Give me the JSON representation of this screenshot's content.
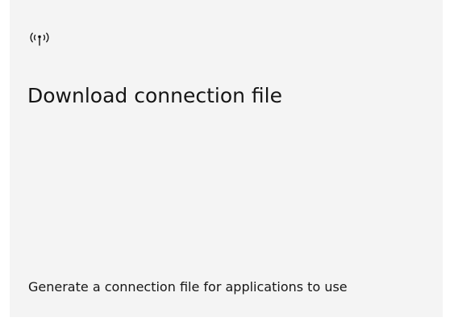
{
  "tile": {
    "icon": "connection-signal-icon",
    "title": "Download connection file",
    "description": "Generate a connection file for applications to use"
  }
}
